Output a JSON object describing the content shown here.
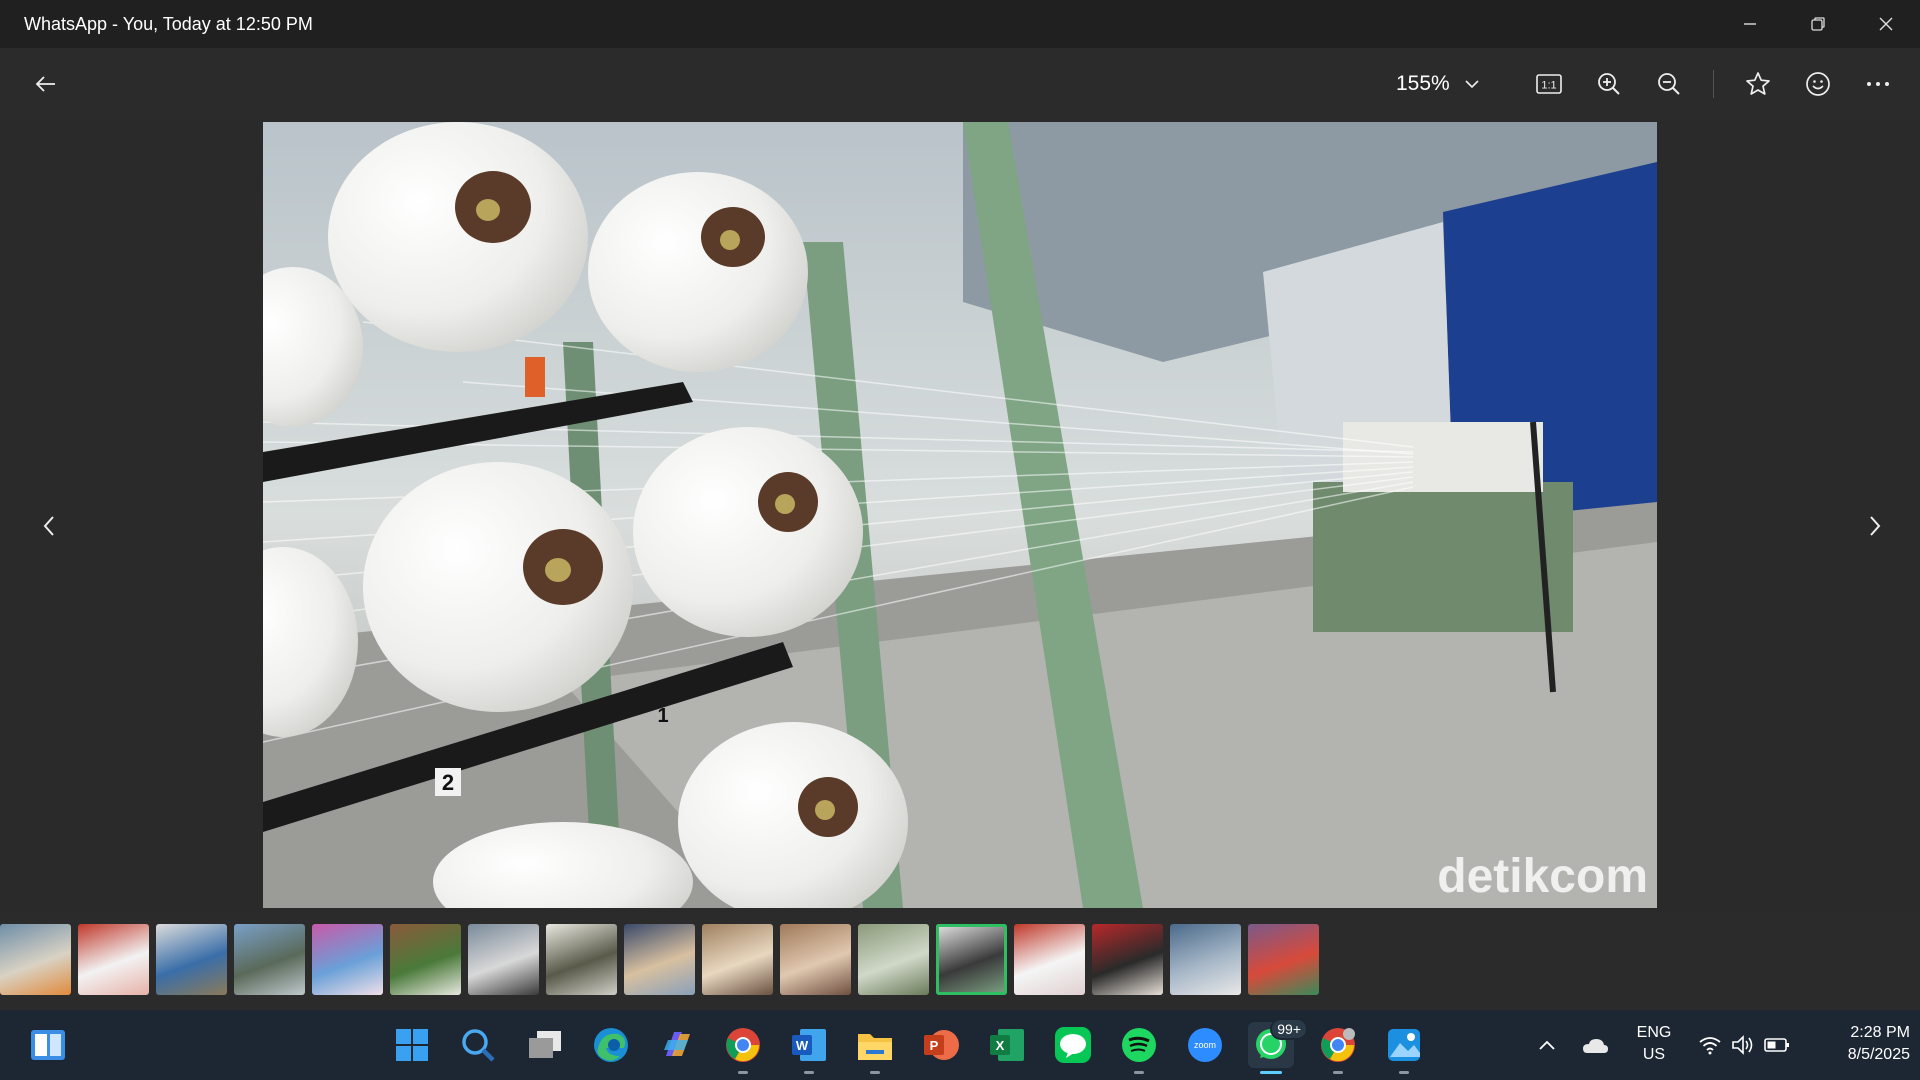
{
  "window": {
    "title": "WhatsApp - You, Today at 12:50 PM",
    "controls": [
      "minimize-icon",
      "restore-icon",
      "close-icon"
    ]
  },
  "toolbar": {
    "zoom_level": "155%",
    "actions": [
      "actual-size-icon",
      "zoom-in-icon",
      "zoom-out-icon",
      "favorite-icon",
      "emoji-icon",
      "more-icon"
    ]
  },
  "photo": {
    "watermark": "detikcom",
    "bobbin_labels": [
      "1",
      "2"
    ]
  },
  "filmstrip": {
    "count": 17,
    "active_index": 12
  },
  "taskbar": {
    "apps": [
      "widgets-icon",
      "start-icon",
      "search-icon",
      "task-view-icon",
      "edge-icon",
      "copilot-icon",
      "chrome-icon",
      "word-icon",
      "file-explorer-icon",
      "powerpoint-icon",
      "excel-icon",
      "line-icon",
      "spotify-icon",
      "zoom-app-icon",
      "whatsapp-icon",
      "chrome-profile-icon",
      "photos-icon"
    ],
    "whatsapp_badge": "99+",
    "zoom_label": "zoom",
    "tray": {
      "lang_line1": "ENG",
      "lang_line2": "US",
      "time": "2:28 PM",
      "date": "8/5/2025"
    }
  },
  "colors": {
    "titlebar_bg": "#202020",
    "viewer_bg": "#2b2b2b",
    "taskbar_bg": "#1c2733",
    "accent_green": "#2fbf63",
    "accent_blue": "#60cdff"
  }
}
